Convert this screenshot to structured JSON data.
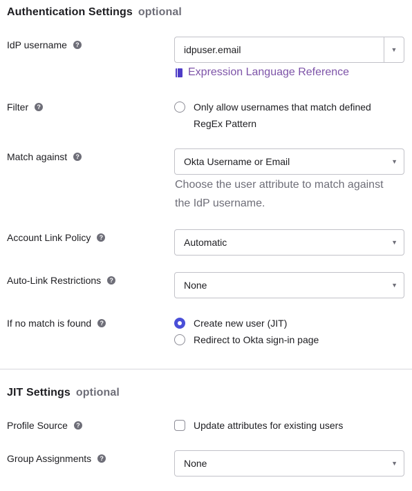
{
  "auth_section": {
    "title": "Authentication Settings",
    "optional": "optional",
    "idp_username": {
      "label": "IdP username",
      "value": "idpuser.email",
      "link": "Expression Language Reference"
    },
    "filter": {
      "label": "Filter",
      "checkbox_label_line1": "Only allow usernames that match defined",
      "checkbox_label_line2": "RegEx Pattern",
      "checked": false
    },
    "match_against": {
      "label": "Match against",
      "value": "Okta Username or Email",
      "help_line1": "Choose the user attribute to match against",
      "help_line2": "the IdP username."
    },
    "account_link_policy": {
      "label": "Account Link Policy",
      "value": "Automatic"
    },
    "auto_link_restrictions": {
      "label": "Auto-Link Restrictions",
      "value": "None"
    },
    "no_match": {
      "label": "If no match is found",
      "options": [
        "Create new user (JIT)",
        "Redirect to Okta sign-in page"
      ],
      "selected": "Create new user (JIT)"
    }
  },
  "jit_section": {
    "title": "JIT Settings",
    "optional": "optional",
    "profile_source": {
      "label": "Profile Source",
      "checkbox_label": "Update attributes for existing users",
      "checked": false
    },
    "group_assignments": {
      "label": "Group Assignments",
      "value": "None"
    }
  },
  "icons": {
    "help": "question-mark-help-icon",
    "caret": "caret-down-icon",
    "book": "book-icon"
  },
  "colors": {
    "accent_radio": "#4a4fd8",
    "link": "#7d53a8",
    "muted_text": "#6e6e78"
  }
}
